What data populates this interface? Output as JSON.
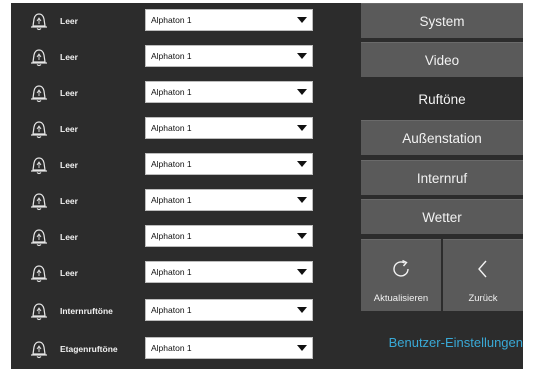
{
  "rows": [
    {
      "label": "Leer",
      "value": "Alphaton 1"
    },
    {
      "label": "Leer",
      "value": "Alphaton 1"
    },
    {
      "label": "Leer",
      "value": "Alphaton 1"
    },
    {
      "label": "Leer",
      "value": "Alphaton 1"
    },
    {
      "label": "Leer",
      "value": "Alphaton 1"
    },
    {
      "label": "Leer",
      "value": "Alphaton 1"
    },
    {
      "label": "Leer",
      "value": "Alphaton 1"
    },
    {
      "label": "Leer",
      "value": "Alphaton 1"
    },
    {
      "label": "Internruftöne",
      "value": "Alphaton 1"
    },
    {
      "label": "Etagenruftöne",
      "value": "Alphaton 1"
    }
  ],
  "menu": {
    "items": [
      {
        "label": "System"
      },
      {
        "label": "Video"
      },
      {
        "label": "Ruftöne",
        "active": true
      },
      {
        "label": "Außenstation"
      },
      {
        "label": "Internruf"
      },
      {
        "label": "Wetter"
      }
    ],
    "refresh_label": "Aktualisieren",
    "back_label": "Zurück",
    "user_settings_label": "Benutzer-Einstellungen"
  },
  "icons": {
    "row_icon": "bell-icon",
    "refresh_icon": "refresh-icon",
    "back_icon": "chevron-left-icon"
  },
  "colors": {
    "background": "#2c2c2c",
    "button": "#5a5a5a",
    "accent_text": "#39a9d6"
  }
}
